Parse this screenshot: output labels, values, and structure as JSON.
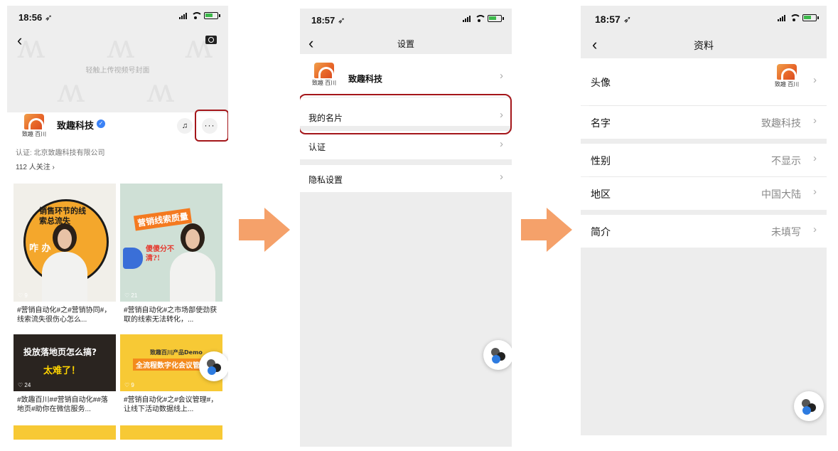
{
  "colors": {
    "highlight": "#a4161a",
    "arrow": "#f5a16a",
    "brand": "#e8692a",
    "verified": "#3b82f6"
  },
  "screen1": {
    "status_time": "18:56 ➶",
    "cover_hint": "轻触上传视频号封面",
    "brand_text": "致趣 百川",
    "account_name": "致趣科技",
    "more_label": "···",
    "certification": "认证: 北京致趣科技有限公司",
    "followers": "112 人关注 ›",
    "cards": [
      {
        "likes": "♡ 9",
        "caption": "#营销自动化#之#营销协同#，线索流失很伤心怎么...",
        "sticker_top": "销售环节的线索总流失",
        "sticker_side": "咋  办"
      },
      {
        "likes": "♡ 21",
        "caption": "#营销自动化#之市场部使劲获取的线索无法转化，...",
        "sticker_top": "营销线索质量",
        "sticker_side": "傻傻分不清?!"
      },
      {
        "likes": "♡ 24",
        "caption": "#致趣百川##营销自动化##落地页#助你在微信服务...",
        "sticker_top": "投放落地页怎么搞?",
        "sticker_side": "太难了！"
      },
      {
        "likes": "♡ 9",
        "caption": "#营销自动化#之#会议管理#，让线下活动数据线上...",
        "sticker_top": "致趣百川产品Demo",
        "sticker_side": "全流程数字化会议管理"
      }
    ]
  },
  "screen2": {
    "status_time": "18:57 ➶",
    "title": "设置",
    "account_name": "致趣科技",
    "brand_text": "致趣 百川",
    "rows": [
      {
        "label": "我的名片"
      },
      {
        "label": "认证"
      },
      {
        "label": "隐私设置"
      }
    ]
  },
  "screen3": {
    "status_time": "18:57 ➶",
    "title": "资料",
    "brand_text": "致趣 百川",
    "rows": [
      {
        "label": "头像",
        "value": ""
      },
      {
        "label": "名字",
        "value": "致趣科技"
      },
      {
        "label": "性别",
        "value": "不显示"
      },
      {
        "label": "地区",
        "value": "中国大陆"
      },
      {
        "label": "简介",
        "value": "未填写"
      }
    ]
  }
}
